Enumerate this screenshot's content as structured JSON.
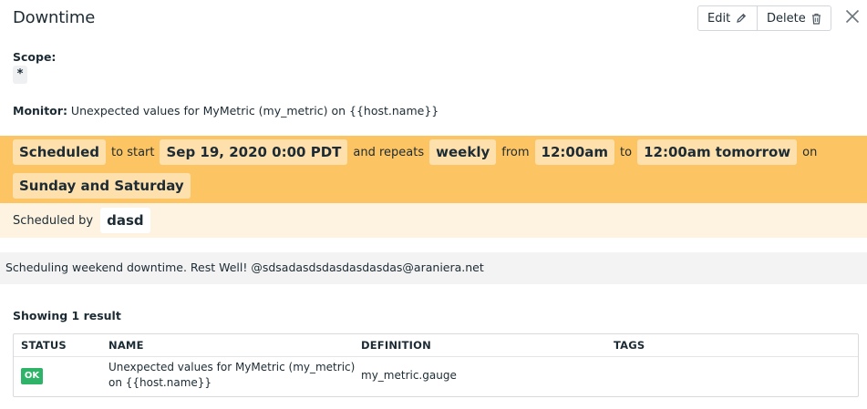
{
  "header": {
    "title": "Downtime",
    "edit_label": "Edit",
    "delete_label": "Delete"
  },
  "scope": {
    "label": "Scope:",
    "value": "*"
  },
  "monitor": {
    "label": "Monitor:",
    "value": "Unexpected values for MyMetric (my_metric) on {{host.name}}"
  },
  "schedule": {
    "status": "Scheduled",
    "to_start_text": "to start",
    "start": "Sep 19, 2020 0:00 PDT",
    "and_repeats_text": "and repeats",
    "frequency": "weekly",
    "from_text": "from",
    "from_time": "12:00am",
    "to_text": "to",
    "to_time": "12:00am tomorrow",
    "on_text": "on",
    "days": "Sunday and Saturday",
    "scheduled_by_text": "Scheduled by",
    "scheduled_by": "dasd"
  },
  "message": "Scheduling weekend downtime. Rest Well! @sdsadasdsdasdasdasdas@araniera.net",
  "results": {
    "label": "Showing 1 result",
    "columns": [
      "STATUS",
      "NAME",
      "DEFINITION",
      "TAGS"
    ],
    "rows": [
      {
        "status": "OK",
        "name_line1": "Unexpected values for MyMetric (my_metric)",
        "name_line2": "on {{host.name}}",
        "definition": "my_metric.gauge",
        "tags": ""
      }
    ]
  },
  "colors": {
    "schedule_band": "#fcc463",
    "schedule_pill": "#fee0ad",
    "scheduled_by_band": "#fef3e0",
    "ok_badge": "#2fb369"
  },
  "icons": [
    "pencil-icon",
    "trash-icon",
    "close-icon"
  ]
}
